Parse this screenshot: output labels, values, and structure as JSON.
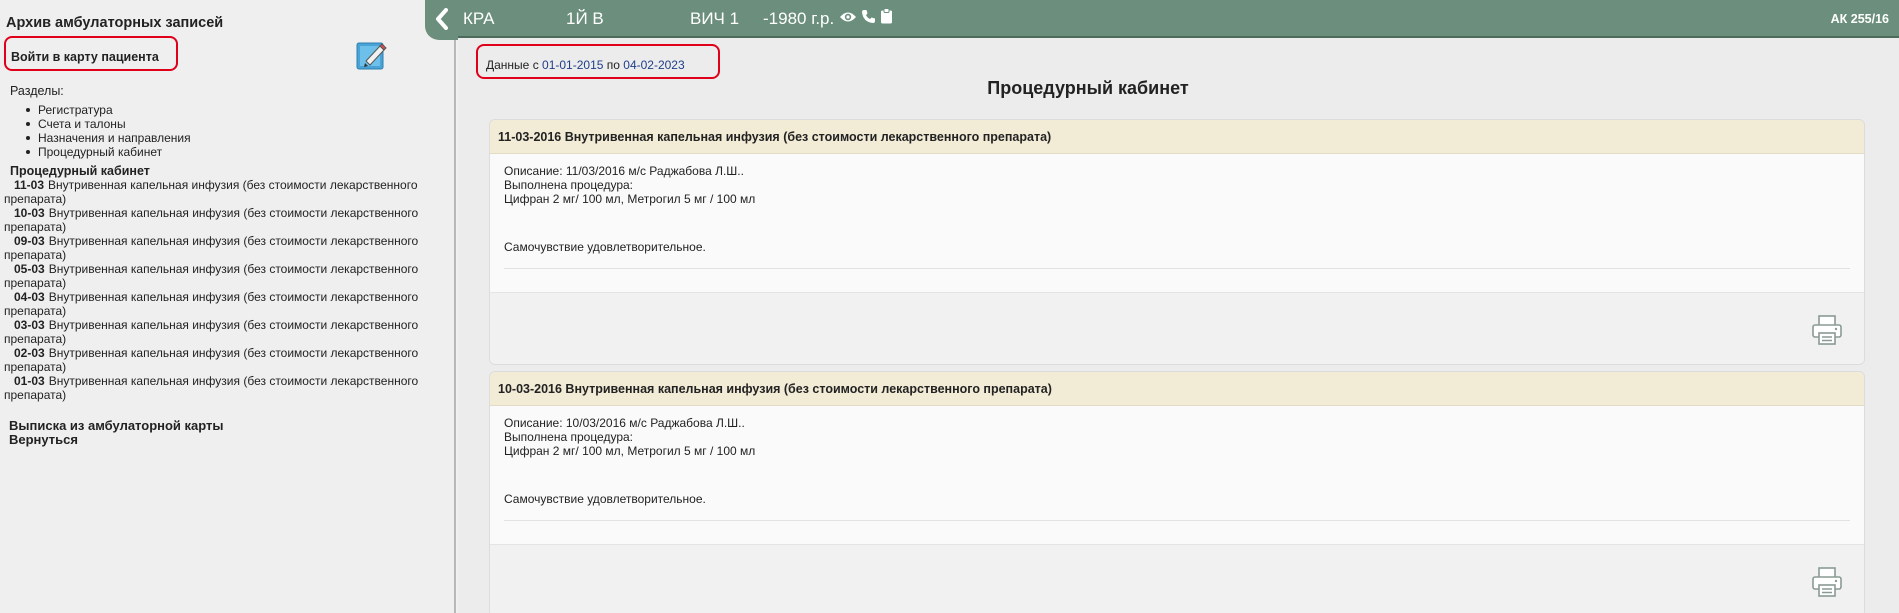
{
  "sidebar": {
    "title": "Архив амбулаторных записей",
    "enter_card": "Войти в карту пациента",
    "sections_label": "Разделы:",
    "sections": [
      "Регистратура",
      "Счета и талоны",
      "Назначения и направления",
      "Процедурный кабинет"
    ],
    "proc_heading": "Процедурный кабинет",
    "proc_items": [
      {
        "date": "11-03",
        "text": "Внутривенная капельная инфузия (без стоимости лекарственного препарата)"
      },
      {
        "date": "10-03",
        "text": "Внутривенная капельная инфузия (без стоимости лекарственного препарата)"
      },
      {
        "date": "09-03",
        "text": "Внутривенная капельная инфузия (без стоимости лекарственного препарата)"
      },
      {
        "date": "05-03",
        "text": "Внутривенная капельная инфузия (без стоимости лекарственного препарата)"
      },
      {
        "date": "04-03",
        "text": "Внутривенная капельная инфузия (без стоимости лекарственного препарата)"
      },
      {
        "date": "03-03",
        "text": "Внутривенная капельная инфузия (без стоимости лекарственного препарата)"
      },
      {
        "date": "02-03",
        "text": "Внутривенная капельная инфузия (без стоимости лекарственного препарата)"
      },
      {
        "date": "01-03",
        "text": "Внутривенная капельная инфузия (без стоимости лекарственного препарата)"
      }
    ],
    "extract": "Выписка из амбулаторной карты",
    "back": "Вернуться"
  },
  "header": {
    "name1": "КРА",
    "name2": "1Й В",
    "name3": "ВИЧ 1",
    "birth": "-1980 г.р.",
    "card_no": "АК 255/16"
  },
  "main": {
    "date_prefix": "Данные с ",
    "date_from": "01-01-2015",
    "date_mid": " по ",
    "date_to": "04-02-2023",
    "title": "Процедурный кабинет",
    "records": [
      {
        "title": "11-03-2016 Внутривенная капельная инфузия (без стоимости лекарственного препарата)",
        "description": "Описание: 11/03/2016 м/с Раджабова Л.Ш..",
        "performed": "Выполнена процедура:",
        "drugs": "Цифран 2 мг/ 100 мл, Метрогил 5 мг / 100 мл",
        "wellbeing": "Самочувствие удовлетворительное."
      },
      {
        "title": "10-03-2016 Внутривенная капельная инфузия (без стоимости лекарственного препарата)",
        "description": "Описание: 10/03/2016 м/с Раджабова Л.Ш..",
        "performed": "Выполнена процедура:",
        "drugs": "Цифран 2 мг/ 100 мл, Метрогил 5 мг / 100 мл",
        "wellbeing": "Самочувствие удовлетворительное."
      }
    ]
  },
  "colors": {
    "header_bg": "#6b8f7c",
    "highlight": "#e0001a",
    "card_head": "#f2ebd6",
    "link": "#1f3f8a"
  },
  "icons": [
    "chevron-left-icon",
    "eye-icon",
    "phone-icon",
    "clipboard-icon",
    "pencil-icon",
    "printer-icon"
  ]
}
